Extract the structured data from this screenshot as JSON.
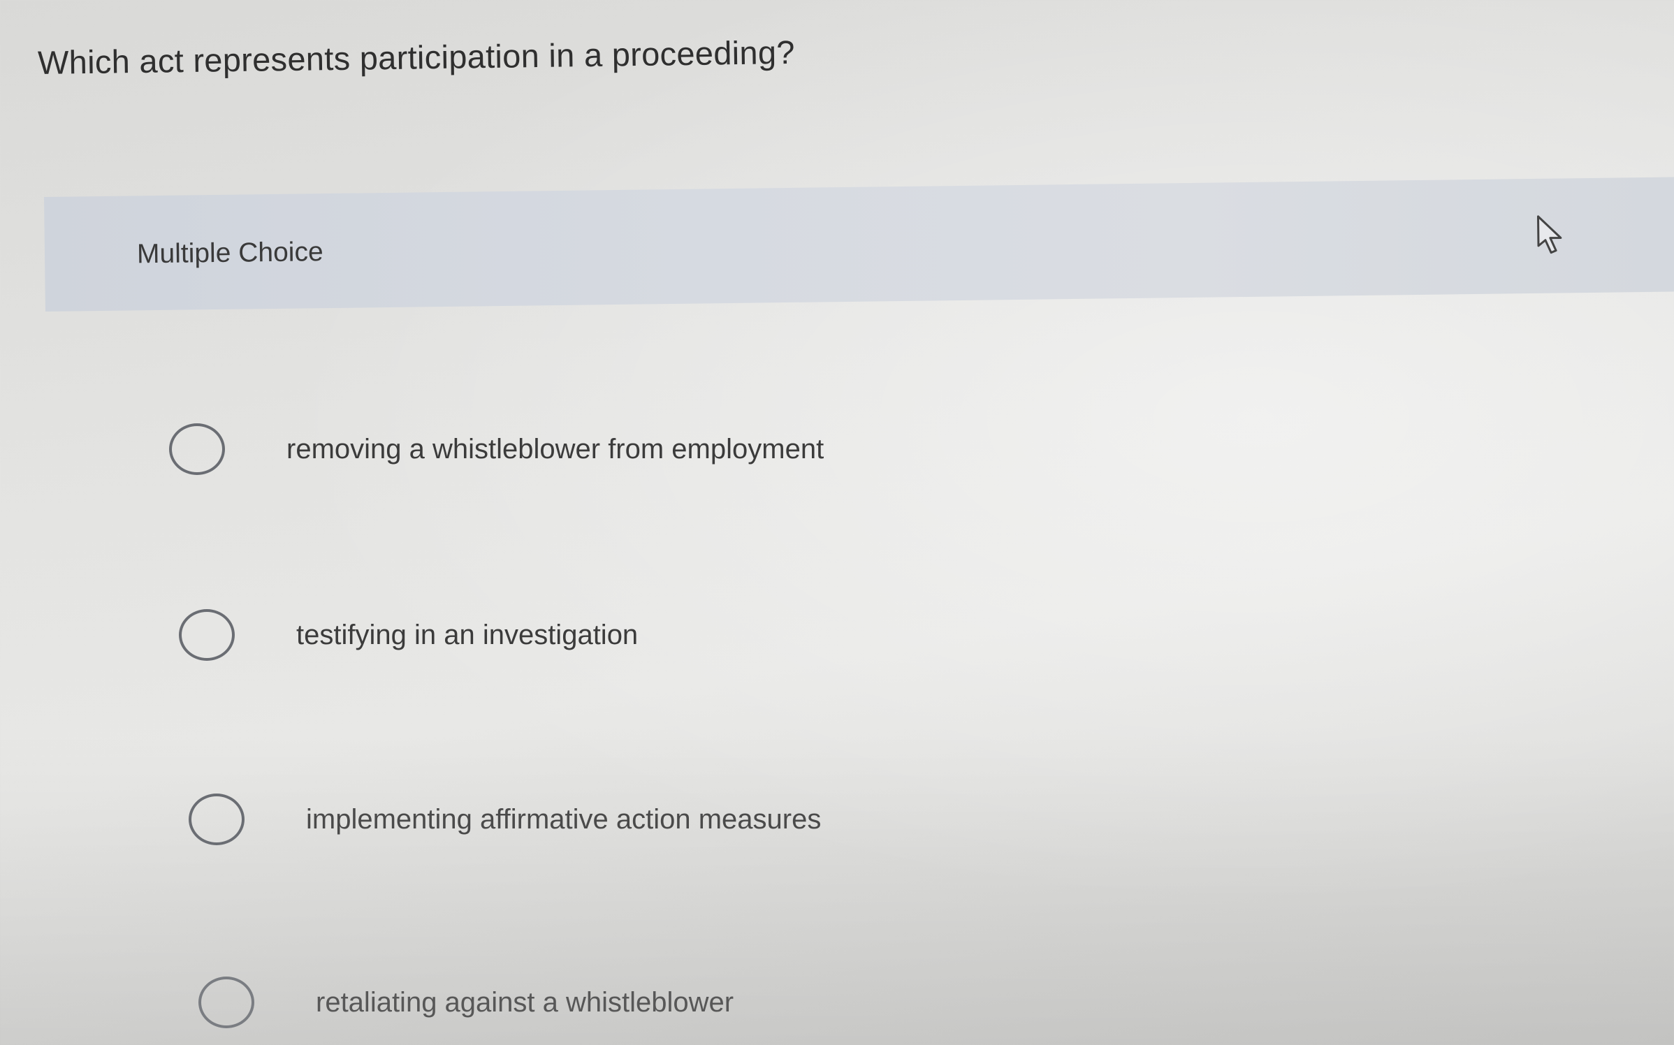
{
  "question": {
    "text": "Which act represents participation in a proceeding?"
  },
  "section": {
    "label": "Multiple Choice"
  },
  "options": [
    {
      "label": "removing a whistleblower from employment",
      "selected": false
    },
    {
      "label": "testifying in an investigation",
      "selected": false
    },
    {
      "label": "implementing affirmative action measures",
      "selected": false
    },
    {
      "label": "retaliating against a whistleblower",
      "selected": false
    }
  ],
  "icons": {
    "cursor": "mouse-pointer-icon",
    "radio": "radio-button-icon"
  },
  "colors": {
    "section_band": "#d4d8de",
    "background": "#e3e3e1",
    "text": "#333333",
    "radio_border": "#6a6d73"
  }
}
